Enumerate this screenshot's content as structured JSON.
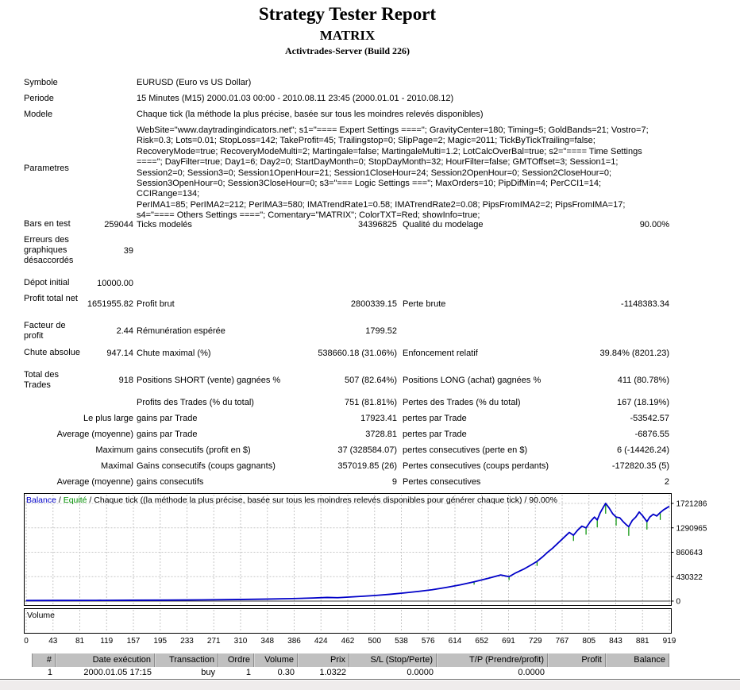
{
  "header": {
    "title": "Strategy Tester Report",
    "subtitle": "MATRIX",
    "server": "Activtrades-Server (Build 226)"
  },
  "summary": {
    "info": [
      {
        "label": "Symbole",
        "value": "EURUSD (Euro vs US Dollar)"
      },
      {
        "label": "Periode",
        "value": "15 Minutes (M15) 2000.01.03 00:00 - 2010.08.11 23:45 (2000.01.01 - 2010.08.12)"
      },
      {
        "label": "Modele",
        "value": "Chaque tick (la méthode la plus précise, basée sur tous les moindres relevés disponibles)"
      }
    ],
    "parametres": {
      "label": "Parametres",
      "lines": [
        "WebSite=\"www.daytradingindicators.net\"; s1=\"==== Expert Settings ====\"; GravityCenter=180; Timing=5; GoldBands=21; Vostro=7;",
        "Risk=0.3; Lots=0.01; StopLoss=142; TakeProfit=45; Trailingstop=0; SlipPage=2; Magic=2011; TickByTickTrailing=false;",
        "RecoveryMode=true; RecoveryModeMulti=2; Martingale=false; MartingaleMulti=1.2; LotCalcOverBal=true; s2=\"==== Time Settings",
        "====\"; DayFilter=true; Day1=6; Day2=0; StartDayMonth=0; StopDayMonth=32; HourFilter=false; GMTOffset=3; Session1=1;",
        "Session2=0; Session3=0; Session1OpenHour=21; Session1CloseHour=24; Session2OpenHour=0; Session2CloseHour=0;",
        "Session3OpenHour=0; Session3CloseHour=0; s3=\"=== Logic Settings ===\"; MaxOrders=10; PipDifMin=4; PerCCI1=14; CCIRange=134;",
        "PerIMA1=85; PerIMA2=212; PerIMA3=580; IMATrendRate1=0.58; IMATrendRate2=0.08; PipsFromIMA2=2; PipsFromIMA=17;",
        "s4=\"==== Others Settings ====\"; Comentary=\"MATRIX\"; ColorTXT=Red; showInfo=true;"
      ]
    },
    "stats": [
      {
        "label": "Bars en test",
        "v1": "259044",
        "l2": "Ticks modelés",
        "v2": "34396825",
        "l3": "Qualité du modelage",
        "v3": "90.00%"
      },
      {
        "label": "Erreurs des graphiques désaccordés",
        "v1": "39"
      },
      {
        "label": "Dépot initial",
        "v1": "10000.00"
      },
      {
        "label": "Profit total net",
        "v1": "1651955.82",
        "l2": "Profit brut",
        "v2": "2800339.15",
        "l3": "Perte brute",
        "v3": "-1148383.34"
      },
      {
        "label": "Facteur de profit",
        "v1": "2.44",
        "l2": "Rémunération espérée",
        "v2": "1799.52"
      },
      {
        "label": "Chute absolue",
        "v1": "947.14",
        "l2": "Chute maximal (%)",
        "v2": "538660.18 (31.06%)",
        "l3": "Enfoncement relatif",
        "v3": "39.84% (8201.23)"
      },
      {
        "label": "Total des Trades",
        "v1": "918",
        "l2": "Positions SHORT (vente) gagnées %",
        "v2": "507 (82.64%)",
        "l3": "Positions LONG (achat) gagnées %",
        "v3": "411 (80.78%)"
      },
      {
        "l2": "Profits des Trades (% du total)",
        "v2": "751 (81.81%)",
        "l3": "Pertes des Trades (% du total)",
        "v3": "167 (18.19%)"
      },
      {
        "label": "Le plus large",
        "l2": "gains par Trade",
        "v2": "17923.41",
        "l3": "pertes par Trade",
        "v3": "-53542.57"
      },
      {
        "label": "Average (moyenne)",
        "l2": "gains par Trade",
        "v2": "3728.81",
        "l3": "pertes par Trade",
        "v3": "-6876.55"
      },
      {
        "label": "Maximum",
        "l2": "gains consecutifs (profit en $)",
        "v2": "37 (328584.07)",
        "l3": "pertes consecutives (perte en $)",
        "v3": "6 (-14426.24)"
      },
      {
        "label": "Maximal",
        "l2": "Gains consecutifs (coups gagnants)",
        "v2": "357019.85 (26)",
        "l3": "Pertes consecutives (coups perdants)",
        "v3": "-172820.35 (5)"
      },
      {
        "label": "Average (moyenne)",
        "l2": "gains consecutifs",
        "v2": "9",
        "l3": "Pertes consecutives",
        "v3": "2"
      }
    ]
  },
  "chart_data": {
    "type": "line",
    "legend": {
      "balance": "Balance",
      "sep": " / ",
      "equity": "Equité",
      "description": "Chaque tick ((la méthode la plus précise, basée sur tous les moindres relevés disponibles pour générer chaque tick) / 90.00%"
    },
    "volume_label": "Volume",
    "ylim": [
      0,
      1721286
    ],
    "y_ticks": [
      1721286,
      1290965,
      860643,
      430322,
      0
    ],
    "x_ticks": [
      0,
      43,
      81,
      119,
      157,
      195,
      233,
      271,
      310,
      348,
      386,
      424,
      462,
      500,
      538,
      576,
      614,
      652,
      691,
      729,
      767,
      805,
      843,
      881,
      919
    ],
    "grid": true,
    "legend_position": "top-left",
    "balance_color": "#0000c8",
    "equity_color": "#009000",
    "series": [
      {
        "name": "Balance",
        "color": "#0000c8",
        "points": [
          [
            0,
            10000
          ],
          [
            50,
            11000
          ],
          [
            100,
            12500
          ],
          [
            150,
            14500
          ],
          [
            200,
            17000
          ],
          [
            250,
            21000
          ],
          [
            300,
            27000
          ],
          [
            340,
            34000
          ],
          [
            380,
            44000
          ],
          [
            410,
            54000
          ],
          [
            430,
            64000
          ],
          [
            445,
            59000
          ],
          [
            460,
            70000
          ],
          [
            480,
            84000
          ],
          [
            500,
            100000
          ],
          [
            520,
            120000
          ],
          [
            540,
            143000
          ],
          [
            560,
            170000
          ],
          [
            580,
            200000
          ],
          [
            600,
            240000
          ],
          [
            620,
            285000
          ],
          [
            640,
            340000
          ],
          [
            660,
            400000
          ],
          [
            678,
            460000
          ],
          [
            690,
            430000
          ],
          [
            700,
            500000
          ],
          [
            712,
            570000
          ],
          [
            722,
            640000
          ],
          [
            730,
            700000
          ],
          [
            738,
            780000
          ],
          [
            745,
            860000
          ],
          [
            752,
            930000
          ],
          [
            758,
            1000000
          ],
          [
            764,
            1070000
          ],
          [
            770,
            1140000
          ],
          [
            776,
            1210000
          ],
          [
            782,
            1160000
          ],
          [
            788,
            1250000
          ],
          [
            794,
            1320000
          ],
          [
            800,
            1290000
          ],
          [
            806,
            1400000
          ],
          [
            812,
            1480000
          ],
          [
            816,
            1430000
          ],
          [
            820,
            1550000
          ],
          [
            824,
            1640000
          ],
          [
            828,
            1721286
          ],
          [
            833,
            1640000
          ],
          [
            838,
            1540000
          ],
          [
            843,
            1480000
          ],
          [
            848,
            1470000
          ],
          [
            853,
            1400000
          ],
          [
            858,
            1340000
          ],
          [
            861,
            1311000
          ],
          [
            866,
            1420000
          ],
          [
            871,
            1480000
          ],
          [
            876,
            1570000
          ],
          [
            881,
            1500000
          ],
          [
            887,
            1400000
          ],
          [
            891,
            1480000
          ],
          [
            896,
            1530000
          ],
          [
            901,
            1500000
          ],
          [
            906,
            1560000
          ],
          [
            911,
            1610000
          ],
          [
            915,
            1640000
          ],
          [
            919,
            1670000
          ]
        ]
      }
    ],
    "equity_dips": [
      [
        640,
        340000,
        290000
      ],
      [
        690,
        430000,
        370000
      ],
      [
        730,
        700000,
        620000
      ],
      [
        782,
        1160000,
        1060000
      ],
      [
        800,
        1290000,
        1170000
      ],
      [
        816,
        1430000,
        1300000
      ],
      [
        828,
        1721286,
        1540000
      ],
      [
        843,
        1480000,
        1330000
      ],
      [
        861,
        1311000,
        1150000
      ],
      [
        887,
        1400000,
        1260000
      ],
      [
        906,
        1560000,
        1430000
      ]
    ]
  },
  "trade_table": {
    "columns": [
      "#",
      "Date exécution",
      "Transaction",
      "Ordre",
      "Volume",
      "Prix",
      "S/L (Stop/Perte)",
      "T/P (Prendre/profit)",
      "Profit",
      "Balance"
    ],
    "rows": [
      [
        "1",
        "2000.01.05 17:15",
        "buy",
        "1",
        "0.30",
        "1.0322",
        "0.0000",
        "0.0000",
        "",
        ""
      ]
    ]
  }
}
